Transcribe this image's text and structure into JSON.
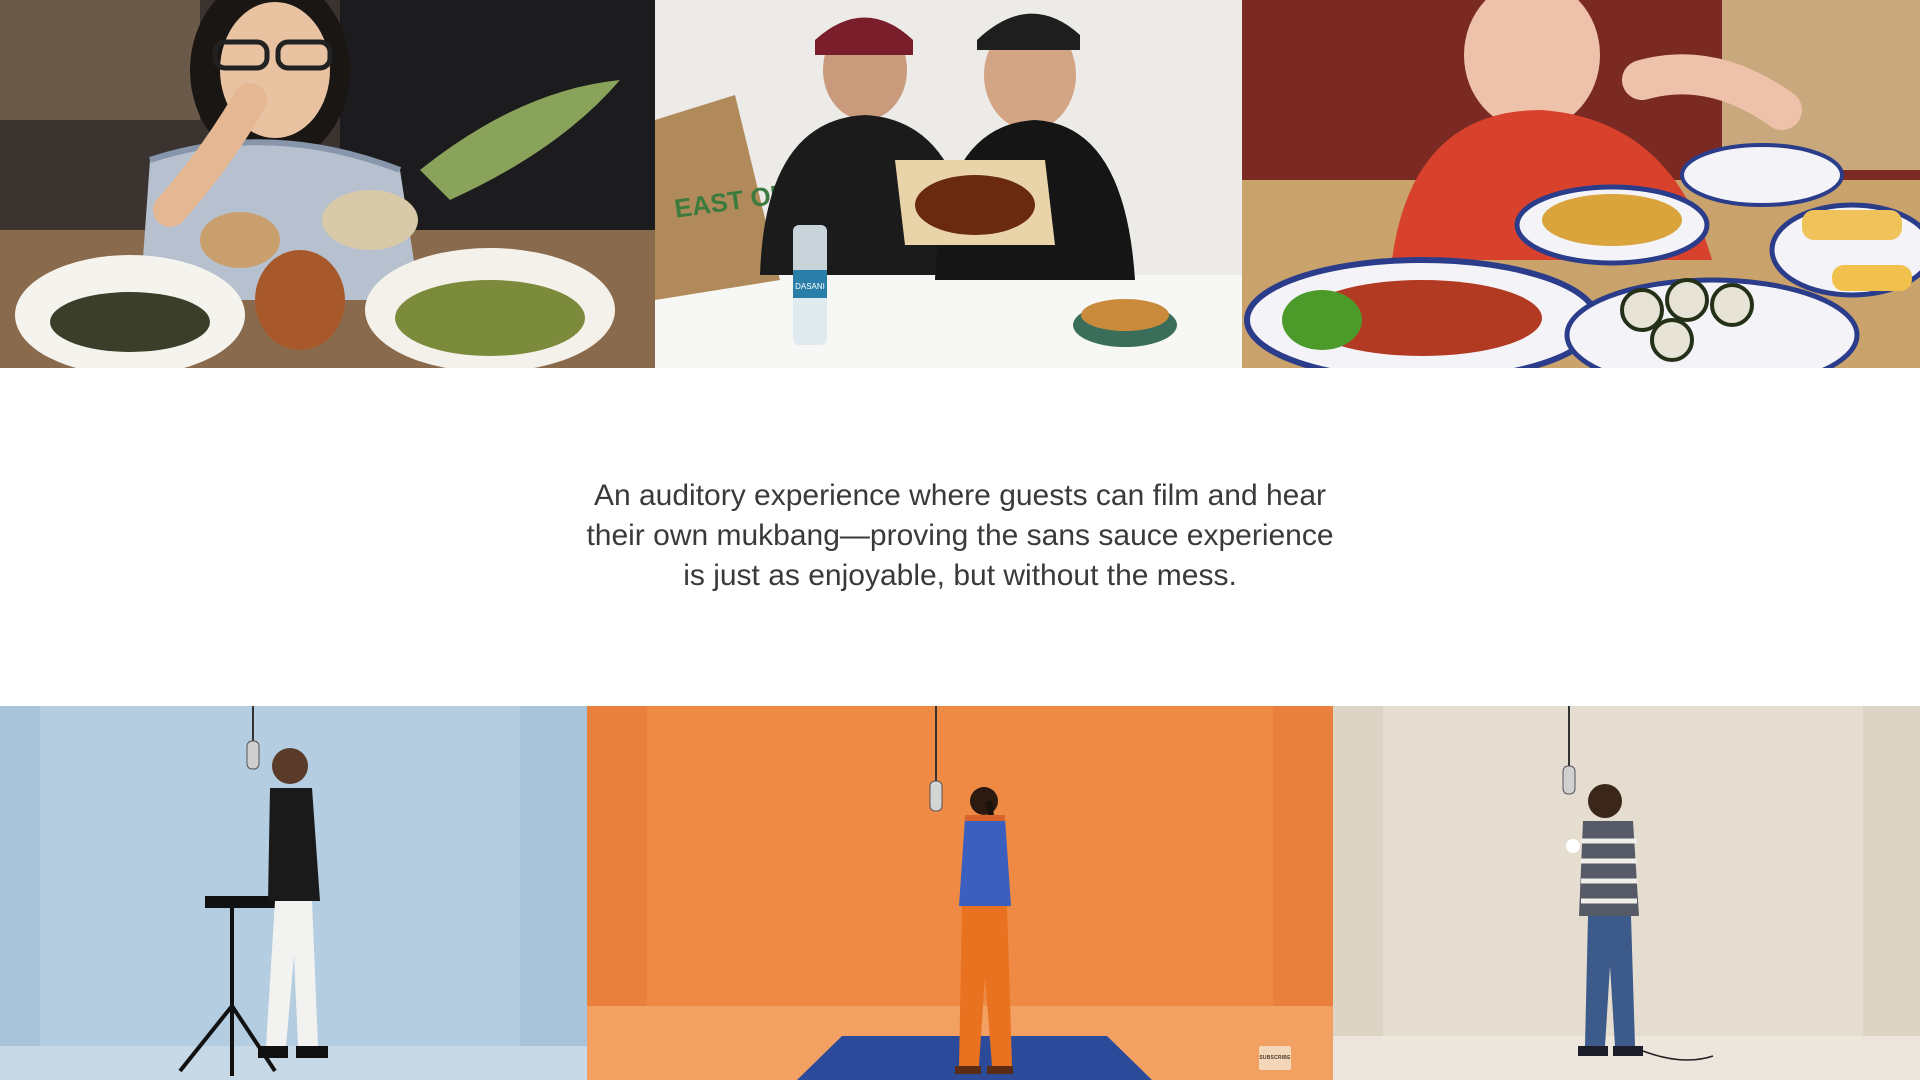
{
  "caption": {
    "lines": [
      "An auditory experience where guests can film and hear",
      "their own mukbang—proving the sans sauce experience",
      "is just as enjoyable, but without the mess."
    ]
  },
  "top_row": {
    "panel_2": {
      "bag_text": "EAST ODE",
      "bottle_label": "DASANI"
    }
  },
  "bottom_row": {
    "panel_2": {
      "subscribe_badge": "SUBSCRIBE"
    }
  },
  "colors": {
    "caption_text": "#3a3a3a",
    "blue_backdrop": "#a9c3d8",
    "orange_backdrop": "#e9803d",
    "beige_backdrop": "#ddd4c6"
  }
}
